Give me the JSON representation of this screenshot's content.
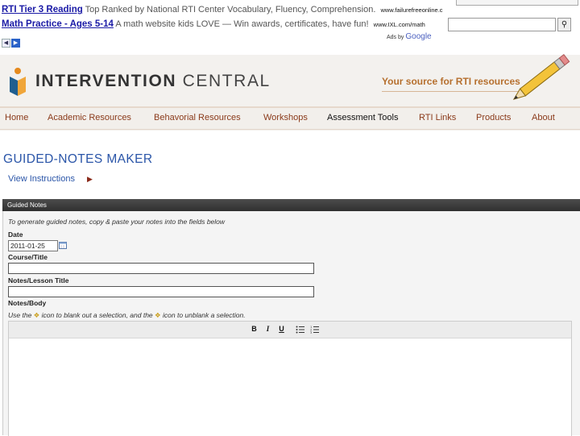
{
  "ads": {
    "items": [
      {
        "title": "RTI Tier 3 Reading",
        "text": "Top Ranked by National RTI Center Vocabulary, Fluency, Comprehension.",
        "url": "www.failurefreeonline.c"
      },
      {
        "title": "Math Practice - Ages 5-14",
        "text": "A math website kids LOVE — Win awards, certificates, have fun!",
        "url": "www.IXL.com/math"
      }
    ],
    "ads_by_label": "Ads by",
    "ads_by_brand": "Google",
    "prev_icon": "arrow-left-icon",
    "next_icon": "arrow-right-icon",
    "search_icon": "magnifier-icon"
  },
  "site": {
    "logo_bold": "INTERVENTION",
    "logo_light": "CENTRAL",
    "tagline": "Your source for RTI resources",
    "brand_color": "#b6702f",
    "nav_color": "#8a3a1a"
  },
  "nav": {
    "items": [
      "Home",
      "Academic Resources",
      "Behavorial Resources",
      "Workshops",
      "Assessment Tools",
      "RTI Links",
      "Products",
      "About"
    ],
    "active": "Assessment Tools"
  },
  "page": {
    "title": "GUIDED-NOTES MAKER",
    "view_instructions": "View Instructions"
  },
  "form": {
    "panel_title": "Guided Notes",
    "hint": "To generate guided notes, copy & paste your notes into the fields below",
    "date_label": "Date",
    "date_value": "2011-01-25",
    "course_label": "Course/Title",
    "course_value": "",
    "lesson_label": "Notes/Lesson Title",
    "lesson_value": "",
    "body_label": "Notes/Body",
    "usage_part1": "Use the",
    "usage_part2": "icon to blank out a selection, and the",
    "usage_part3": "icon to unblank a selection.",
    "toolbar": {
      "bold": "B",
      "italic": "I",
      "underline": "U"
    }
  }
}
